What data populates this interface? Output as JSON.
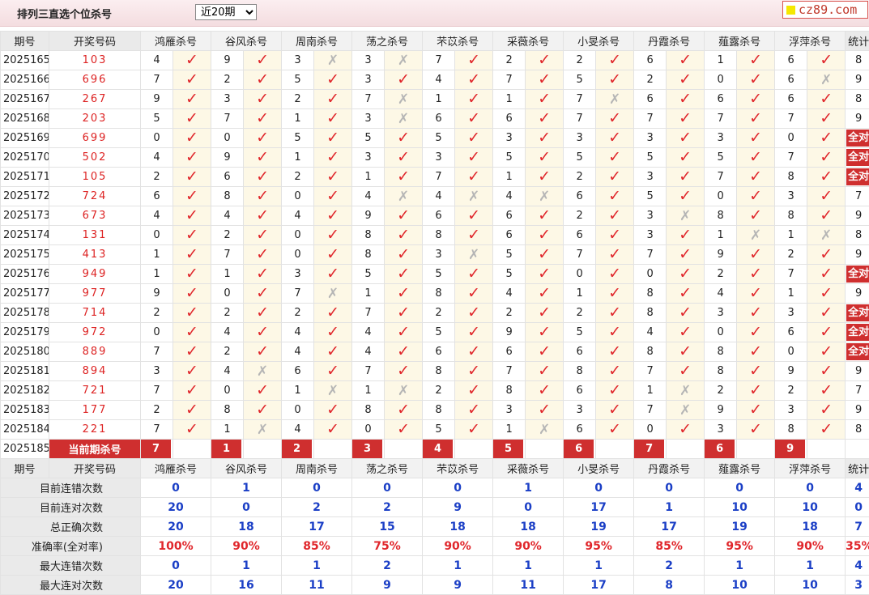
{
  "title": "排列三直选个位杀号",
  "period_select": {
    "selected": "近20期"
  },
  "logo": "cz89.com",
  "headers": [
    "期号",
    "开奖号码",
    "鸿雁杀号",
    "谷风杀号",
    "周南杀号",
    "荡之杀号",
    "芣苡杀号",
    "采薇杀号",
    "小旻杀号",
    "丹霞杀号",
    "薤露杀号",
    "浮萍杀号",
    "统计"
  ],
  "rows": [
    {
      "period": "2025165",
      "draw": "103",
      "kills": [
        [
          "4",
          "✓"
        ],
        [
          "9",
          "✓"
        ],
        [
          "3",
          "✗"
        ],
        [
          "3",
          "✗"
        ],
        [
          "7",
          "✓"
        ],
        [
          "2",
          "✓"
        ],
        [
          "2",
          "✓"
        ],
        [
          "6",
          "✓"
        ],
        [
          "1",
          "✓"
        ],
        [
          "6",
          "✓"
        ]
      ],
      "stat": "8"
    },
    {
      "period": "2025166",
      "draw": "696",
      "kills": [
        [
          "7",
          "✓"
        ],
        [
          "2",
          "✓"
        ],
        [
          "5",
          "✓"
        ],
        [
          "3",
          "✓"
        ],
        [
          "4",
          "✓"
        ],
        [
          "7",
          "✓"
        ],
        [
          "5",
          "✓"
        ],
        [
          "2",
          "✓"
        ],
        [
          "0",
          "✓"
        ],
        [
          "6",
          "✗"
        ]
      ],
      "stat": "9"
    },
    {
      "period": "2025167",
      "draw": "267",
      "kills": [
        [
          "9",
          "✓"
        ],
        [
          "3",
          "✓"
        ],
        [
          "2",
          "✓"
        ],
        [
          "7",
          "✗"
        ],
        [
          "1",
          "✓"
        ],
        [
          "1",
          "✓"
        ],
        [
          "7",
          "✗"
        ],
        [
          "6",
          "✓"
        ],
        [
          "6",
          "✓"
        ],
        [
          "6",
          "✓"
        ]
      ],
      "stat": "8"
    },
    {
      "period": "2025168",
      "draw": "203",
      "kills": [
        [
          "5",
          "✓"
        ],
        [
          "7",
          "✓"
        ],
        [
          "1",
          "✓"
        ],
        [
          "3",
          "✗"
        ],
        [
          "6",
          "✓"
        ],
        [
          "6",
          "✓"
        ],
        [
          "7",
          "✓"
        ],
        [
          "7",
          "✓"
        ],
        [
          "7",
          "✓"
        ],
        [
          "7",
          "✓"
        ]
      ],
      "stat": "9"
    },
    {
      "period": "2025169",
      "draw": "699",
      "kills": [
        [
          "0",
          "✓"
        ],
        [
          "0",
          "✓"
        ],
        [
          "5",
          "✓"
        ],
        [
          "5",
          "✓"
        ],
        [
          "5",
          "✓"
        ],
        [
          "3",
          "✓"
        ],
        [
          "3",
          "✓"
        ],
        [
          "3",
          "✓"
        ],
        [
          "3",
          "✓"
        ],
        [
          "0",
          "✓"
        ]
      ],
      "stat": "全对"
    },
    {
      "period": "2025170",
      "draw": "502",
      "kills": [
        [
          "4",
          "✓"
        ],
        [
          "9",
          "✓"
        ],
        [
          "1",
          "✓"
        ],
        [
          "3",
          "✓"
        ],
        [
          "3",
          "✓"
        ],
        [
          "5",
          "✓"
        ],
        [
          "5",
          "✓"
        ],
        [
          "5",
          "✓"
        ],
        [
          "5",
          "✓"
        ],
        [
          "7",
          "✓"
        ]
      ],
      "stat": "全对"
    },
    {
      "period": "2025171",
      "draw": "105",
      "kills": [
        [
          "2",
          "✓"
        ],
        [
          "6",
          "✓"
        ],
        [
          "2",
          "✓"
        ],
        [
          "1",
          "✓"
        ],
        [
          "7",
          "✓"
        ],
        [
          "1",
          "✓"
        ],
        [
          "2",
          "✓"
        ],
        [
          "3",
          "✓"
        ],
        [
          "7",
          "✓"
        ],
        [
          "8",
          "✓"
        ]
      ],
      "stat": "全对"
    },
    {
      "period": "2025172",
      "draw": "724",
      "kills": [
        [
          "6",
          "✓"
        ],
        [
          "8",
          "✓"
        ],
        [
          "0",
          "✓"
        ],
        [
          "4",
          "✗"
        ],
        [
          "4",
          "✗"
        ],
        [
          "4",
          "✗"
        ],
        [
          "6",
          "✓"
        ],
        [
          "5",
          "✓"
        ],
        [
          "0",
          "✓"
        ],
        [
          "3",
          "✓"
        ]
      ],
      "stat": "7"
    },
    {
      "period": "2025173",
      "draw": "673",
      "kills": [
        [
          "4",
          "✓"
        ],
        [
          "4",
          "✓"
        ],
        [
          "4",
          "✓"
        ],
        [
          "9",
          "✓"
        ],
        [
          "6",
          "✓"
        ],
        [
          "6",
          "✓"
        ],
        [
          "2",
          "✓"
        ],
        [
          "3",
          "✗"
        ],
        [
          "8",
          "✓"
        ],
        [
          "8",
          "✓"
        ]
      ],
      "stat": "9"
    },
    {
      "period": "2025174",
      "draw": "131",
      "kills": [
        [
          "0",
          "✓"
        ],
        [
          "2",
          "✓"
        ],
        [
          "0",
          "✓"
        ],
        [
          "8",
          "✓"
        ],
        [
          "8",
          "✓"
        ],
        [
          "6",
          "✓"
        ],
        [
          "6",
          "✓"
        ],
        [
          "3",
          "✓"
        ],
        [
          "1",
          "✗"
        ],
        [
          "1",
          "✗"
        ]
      ],
      "stat": "8"
    },
    {
      "period": "2025175",
      "draw": "413",
      "kills": [
        [
          "1",
          "✓"
        ],
        [
          "7",
          "✓"
        ],
        [
          "0",
          "✓"
        ],
        [
          "8",
          "✓"
        ],
        [
          "3",
          "✗"
        ],
        [
          "5",
          "✓"
        ],
        [
          "7",
          "✓"
        ],
        [
          "7",
          "✓"
        ],
        [
          "9",
          "✓"
        ],
        [
          "2",
          "✓"
        ]
      ],
      "stat": "9"
    },
    {
      "period": "2025176",
      "draw": "949",
      "kills": [
        [
          "1",
          "✓"
        ],
        [
          "1",
          "✓"
        ],
        [
          "3",
          "✓"
        ],
        [
          "5",
          "✓"
        ],
        [
          "5",
          "✓"
        ],
        [
          "5",
          "✓"
        ],
        [
          "0",
          "✓"
        ],
        [
          "0",
          "✓"
        ],
        [
          "2",
          "✓"
        ],
        [
          "7",
          "✓"
        ]
      ],
      "stat": "全对"
    },
    {
      "period": "2025177",
      "draw": "977",
      "kills": [
        [
          "9",
          "✓"
        ],
        [
          "0",
          "✓"
        ],
        [
          "7",
          "✗"
        ],
        [
          "1",
          "✓"
        ],
        [
          "8",
          "✓"
        ],
        [
          "4",
          "✓"
        ],
        [
          "1",
          "✓"
        ],
        [
          "8",
          "✓"
        ],
        [
          "4",
          "✓"
        ],
        [
          "1",
          "✓"
        ]
      ],
      "stat": "9"
    },
    {
      "period": "2025178",
      "draw": "714",
      "kills": [
        [
          "2",
          "✓"
        ],
        [
          "2",
          "✓"
        ],
        [
          "2",
          "✓"
        ],
        [
          "7",
          "✓"
        ],
        [
          "2",
          "✓"
        ],
        [
          "2",
          "✓"
        ],
        [
          "2",
          "✓"
        ],
        [
          "8",
          "✓"
        ],
        [
          "3",
          "✓"
        ],
        [
          "3",
          "✓"
        ]
      ],
      "stat": "全对"
    },
    {
      "period": "2025179",
      "draw": "972",
      "kills": [
        [
          "0",
          "✓"
        ],
        [
          "4",
          "✓"
        ],
        [
          "4",
          "✓"
        ],
        [
          "4",
          "✓"
        ],
        [
          "5",
          "✓"
        ],
        [
          "9",
          "✓"
        ],
        [
          "5",
          "✓"
        ],
        [
          "4",
          "✓"
        ],
        [
          "0",
          "✓"
        ],
        [
          "6",
          "✓"
        ]
      ],
      "stat": "全对"
    },
    {
      "period": "2025180",
      "draw": "889",
      "kills": [
        [
          "7",
          "✓"
        ],
        [
          "2",
          "✓"
        ],
        [
          "4",
          "✓"
        ],
        [
          "4",
          "✓"
        ],
        [
          "6",
          "✓"
        ],
        [
          "6",
          "✓"
        ],
        [
          "6",
          "✓"
        ],
        [
          "8",
          "✓"
        ],
        [
          "8",
          "✓"
        ],
        [
          "0",
          "✓"
        ]
      ],
      "stat": "全对"
    },
    {
      "period": "2025181",
      "draw": "894",
      "kills": [
        [
          "3",
          "✓"
        ],
        [
          "4",
          "✗"
        ],
        [
          "6",
          "✓"
        ],
        [
          "7",
          "✓"
        ],
        [
          "8",
          "✓"
        ],
        [
          "7",
          "✓"
        ],
        [
          "8",
          "✓"
        ],
        [
          "7",
          "✓"
        ],
        [
          "8",
          "✓"
        ],
        [
          "9",
          "✓"
        ]
      ],
      "stat": "9"
    },
    {
      "period": "2025182",
      "draw": "721",
      "kills": [
        [
          "7",
          "✓"
        ],
        [
          "0",
          "✓"
        ],
        [
          "1",
          "✗"
        ],
        [
          "1",
          "✗"
        ],
        [
          "2",
          "✓"
        ],
        [
          "8",
          "✓"
        ],
        [
          "6",
          "✓"
        ],
        [
          "1",
          "✗"
        ],
        [
          "2",
          "✓"
        ],
        [
          "2",
          "✓"
        ]
      ],
      "stat": "7"
    },
    {
      "period": "2025183",
      "draw": "177",
      "kills": [
        [
          "2",
          "✓"
        ],
        [
          "8",
          "✓"
        ],
        [
          "0",
          "✓"
        ],
        [
          "8",
          "✓"
        ],
        [
          "8",
          "✓"
        ],
        [
          "3",
          "✓"
        ],
        [
          "3",
          "✓"
        ],
        [
          "7",
          "✗"
        ],
        [
          "9",
          "✓"
        ],
        [
          "3",
          "✓"
        ]
      ],
      "stat": "9"
    },
    {
      "period": "2025184",
      "draw": "221",
      "kills": [
        [
          "7",
          "✓"
        ],
        [
          "1",
          "✗"
        ],
        [
          "4",
          "✓"
        ],
        [
          "0",
          "✓"
        ],
        [
          "5",
          "✓"
        ],
        [
          "1",
          "✗"
        ],
        [
          "6",
          "✓"
        ],
        [
          "0",
          "✓"
        ],
        [
          "3",
          "✓"
        ],
        [
          "8",
          "✓"
        ]
      ],
      "stat": "8"
    }
  ],
  "current": {
    "period": "2025185",
    "label": "当前期杀号",
    "kills": [
      "7",
      "1",
      "2",
      "3",
      "4",
      "5",
      "6",
      "7",
      "6",
      "9"
    ]
  },
  "summary": [
    {
      "label": "目前连错次数",
      "values": [
        "0",
        "1",
        "0",
        "0",
        "0",
        "1",
        "0",
        "0",
        "0",
        "0",
        "4"
      ]
    },
    {
      "label": "目前连对次数",
      "values": [
        "20",
        "0",
        "2",
        "2",
        "9",
        "0",
        "17",
        "1",
        "10",
        "10",
        "0"
      ]
    },
    {
      "label": "总正确次数",
      "values": [
        "20",
        "18",
        "17",
        "15",
        "18",
        "18",
        "19",
        "17",
        "19",
        "18",
        "7"
      ]
    },
    {
      "label": "准确率(全对率)",
      "values": [
        "100%",
        "90%",
        "85%",
        "75%",
        "90%",
        "90%",
        "95%",
        "85%",
        "95%",
        "90%",
        "35%"
      ],
      "red": true
    },
    {
      "label": "最大连错次数",
      "values": [
        "0",
        "1",
        "1",
        "2",
        "1",
        "1",
        "1",
        "2",
        "1",
        "1",
        "4"
      ]
    },
    {
      "label": "最大连对次数",
      "values": [
        "20",
        "16",
        "11",
        "9",
        "9",
        "11",
        "17",
        "8",
        "10",
        "10",
        "3"
      ]
    }
  ],
  "colors": {
    "accent": "#cf2f2f",
    "check": "#e0262b",
    "cross": "#b5b5b5",
    "summary_value": "#1b3fc6",
    "mark_bg": "#fdf8e6"
  },
  "icons": {
    "correct": "check-icon",
    "wrong": "cross-icon"
  }
}
